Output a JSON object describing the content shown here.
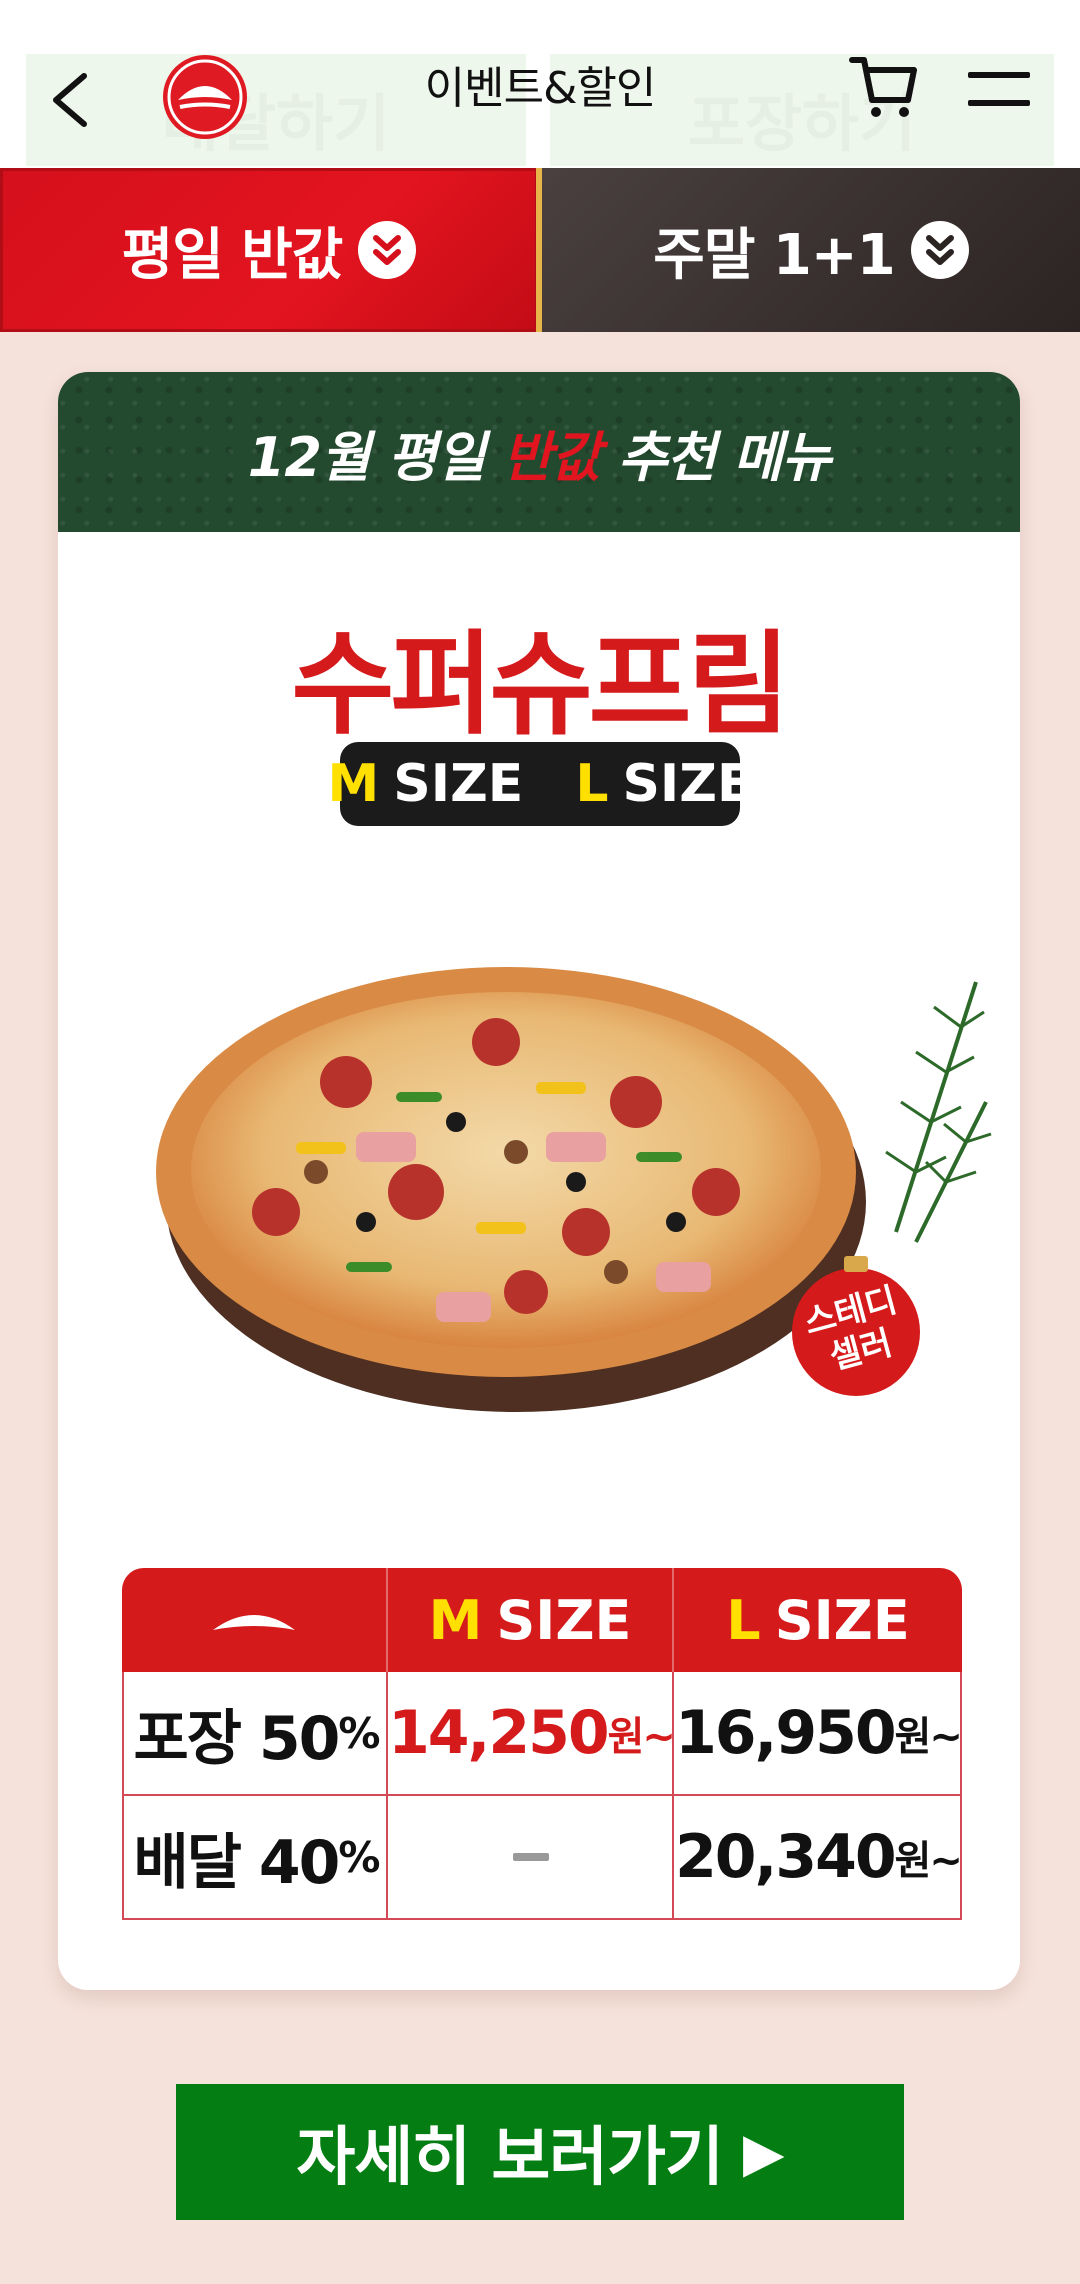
{
  "header": {
    "title": "이벤트&할인",
    "ghost_left": "배달하기",
    "ghost_right": "포장하기"
  },
  "tabs": [
    {
      "label": "평일 반값",
      "active": true
    },
    {
      "label": "주말 1+1",
      "active": false
    }
  ],
  "card": {
    "banner_prefix": "12월 평일 ",
    "banner_accent": "반값",
    "banner_suffix": " 추천 메뉴",
    "pizza_name": "수퍼슈프림",
    "size_m_letter": "M",
    "size_l_letter": "L",
    "size_word": "SIZE",
    "badge": "스테디 셀러"
  },
  "price_table": {
    "head_m_letter": "M",
    "head_l_letter": "L",
    "head_word": "SIZE",
    "rows": [
      {
        "label": "포장 50",
        "unit": "%",
        "m_price": "14,250",
        "m_unit": "원~",
        "l_price": "16,950",
        "l_unit": "원~"
      },
      {
        "label": "배달 40",
        "unit": "%",
        "m_price": "",
        "m_unit": "",
        "l_price": "20,340",
        "l_unit": "원~"
      }
    ]
  },
  "cta": {
    "label": "자세히 보러가기"
  },
  "colors": {
    "brand_red": "#d51a1c",
    "cta_green": "#047d13",
    "banner_green": "#23492f",
    "accent_yellow": "#ffe000"
  }
}
